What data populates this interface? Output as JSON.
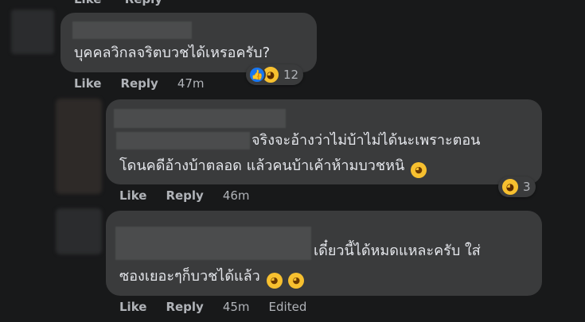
{
  "comments": [
    {
      "text_lines": [
        "บุคคลวิกลจริตบวชได้เหรอครับ?"
      ],
      "actions": {
        "like": "Like",
        "reply": "Reply",
        "time": "47m"
      },
      "reactions": {
        "icons": [
          "like-icon",
          "haha-icon"
        ],
        "count": "12"
      }
    },
    {
      "text_lines": [
        "จริงจะอ้างว่าไม่บ้าไม่ได้นะเพราะตอน",
        "โดนคดีอ้างบ้าตลอด แล้วคนบ้าเค้าห้ามบวชหนิ"
      ],
      "actions": {
        "like": "Like",
        "reply": "Reply",
        "time": "46m"
      },
      "reactions": {
        "icons": [
          "haha-icon"
        ],
        "count": "3"
      },
      "trailing_emoji": "rolling-laugh-emoji"
    },
    {
      "text_lines": [
        "เดี๋ยวนี้ได้หมดแหละครับ ใส่",
        "ซองเยอะๆก็บวชได้แล้ว"
      ],
      "actions": {
        "like": "Like",
        "reply": "Reply",
        "time": "45m",
        "edited": "Edited"
      },
      "trailing_emoji": "sweat-smile-emoji"
    }
  ],
  "top_partial": {
    "like": "Like",
    "reply": "Reply"
  },
  "colors": {
    "background": "#18191a",
    "bubble": "#3a3b3c",
    "text": "#e4e6eb",
    "meta": "#b0b3b8",
    "like_blue": "#1877f2",
    "emoji_yellow": "#f7c02f"
  }
}
